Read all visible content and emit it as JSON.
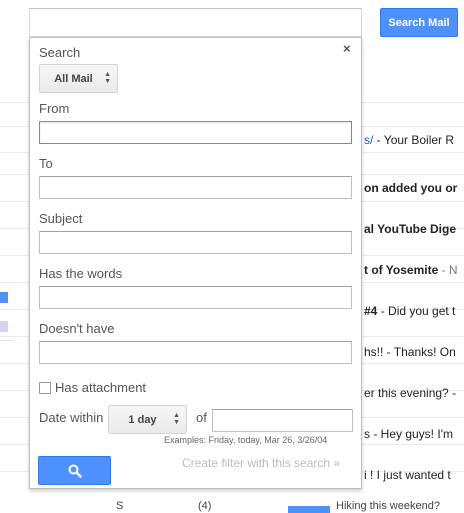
{
  "header": {
    "search_button_label": "Search Mail"
  },
  "background_rows": [
    {
      "subject_tail": "s/",
      "snippet": " - Your Boiler R"
    },
    {
      "subject_tail": "on added you or",
      "snippet": ""
    },
    {
      "subject_tail": "al YouTube Dige",
      "snippet": ""
    },
    {
      "subject_tail": "t of Yosemite",
      "snippet": " - N"
    },
    {
      "subject_tail": "#4",
      "snippet": " - Did you get t"
    },
    {
      "subject_tail": "hs!!",
      "snippet": " - Thanks! On"
    },
    {
      "subject_tail": "er this evening?",
      "snippet": " - "
    },
    {
      "subject_tail": "s",
      "snippet": " - Hey guys! I'm"
    },
    {
      "subject_tail": "i ! I just wanted t",
      "snippet": ""
    }
  ],
  "bottom_row": {
    "sender": "S",
    "count": "(4)",
    "text": "Hiking this weekend?"
  },
  "advanced_search": {
    "close_label": "×",
    "search_label": "Search",
    "search_scope": "All Mail",
    "from_label": "From",
    "from_value": "",
    "to_label": "To",
    "to_value": "",
    "subject_label": "Subject",
    "subject_value": "",
    "has_words_label": "Has the words",
    "has_words_value": "",
    "doesnt_have_label": "Doesn't have",
    "doesnt_have_value": "",
    "has_attachment_label": "Has attachment",
    "date_within_label": "Date within",
    "date_within_value": "1 day",
    "of_label": "of",
    "date_value": "",
    "examples_hint": "Examples: Friday, today, Mar 26, 3/26/04",
    "create_filter_label": "Create filter with this search »"
  },
  "icons": {
    "submit": "search-icon",
    "close": "close-icon",
    "dropdown": "updown-arrow-icon"
  },
  "colors": {
    "accent": "#4d90fe",
    "accent_border": "#3079ed",
    "disabled_text": "#bbbbbb"
  }
}
